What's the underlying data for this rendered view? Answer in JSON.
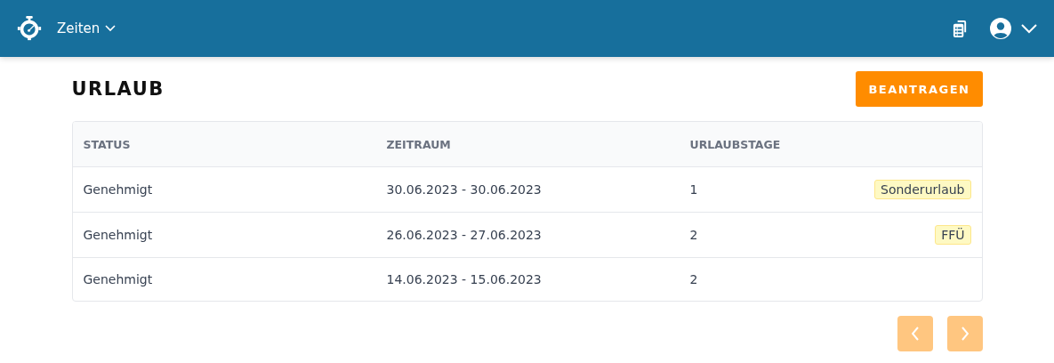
{
  "navbar": {
    "menu": {
      "label": "Zeiten",
      "expanded": false
    }
  },
  "page": {
    "title": "URLAUB",
    "action": "BEANTRAGEN"
  },
  "table": {
    "columns": [
      "STATUS",
      "ZEITRAUM",
      "URLAUBSTAGE"
    ],
    "rows": [
      {
        "status": "Genehmigt",
        "period": "30.06.2023 - 30.06.2023",
        "days": "1",
        "tag": "Sonderurlaub"
      },
      {
        "status": "Genehmigt",
        "period": "26.06.2023 - 27.06.2023",
        "days": "2",
        "tag": "FFÜ"
      },
      {
        "status": "Genehmigt",
        "period": "14.06.2023 - 15.06.2023",
        "days": "2"
      }
    ]
  },
  "pagination": {
    "previous": {
      "disabled": true
    },
    "next": {
      "disabled": true
    }
  }
}
